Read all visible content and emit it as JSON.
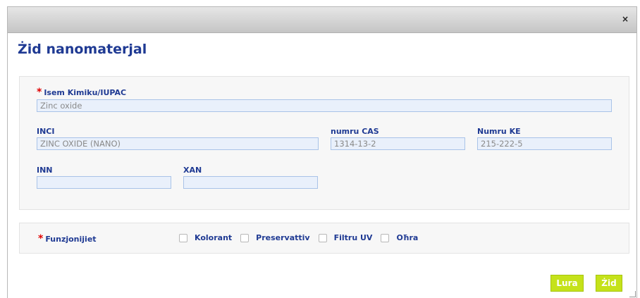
{
  "dialog": {
    "close_glyph": "×",
    "title": "Żid nanomaterjal"
  },
  "form": {
    "chem_name": {
      "label": "Isem Kimiku/IUPAC",
      "value": "Zinc oxide"
    },
    "inci": {
      "label": "INCI",
      "value": "ZINC OXIDE (NANO)"
    },
    "cas": {
      "label": "numru CAS",
      "value": "1314-13-2"
    },
    "ke": {
      "label": "Numru KE",
      "value": "215-222-5"
    },
    "inn": {
      "label": "INN",
      "value": ""
    },
    "xan": {
      "label": "XAN",
      "value": ""
    },
    "required_mark": "*"
  },
  "functions": {
    "label": "Funzjonijiet",
    "options": [
      {
        "label": "Kolorant",
        "checked": false
      },
      {
        "label": "Preservattiv",
        "checked": false
      },
      {
        "label": "Filtru UV",
        "checked": false
      },
      {
        "label": "Oħra",
        "checked": false
      }
    ]
  },
  "buttons": {
    "cancel": "Lura",
    "add": "Żid"
  }
}
